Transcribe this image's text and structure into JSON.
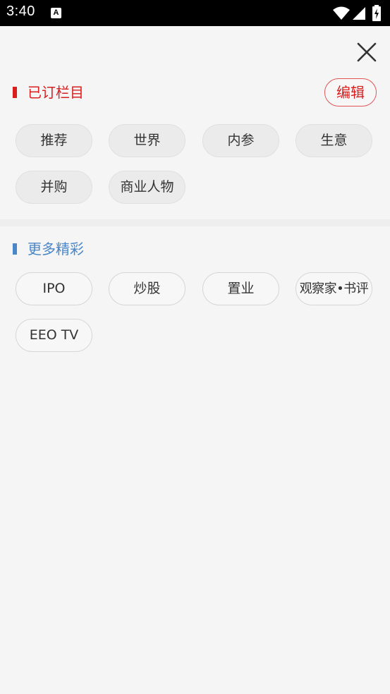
{
  "status_bar": {
    "time": "3:40",
    "notification_icon_letter": "A"
  },
  "colors": {
    "subscribed_accent": "#d81e1e",
    "more_accent": "#4a86c8",
    "background": "#f5f5f5"
  },
  "subscribed": {
    "title": "已订栏目",
    "edit_label": "编辑",
    "items": [
      "推荐",
      "世界",
      "内参",
      "生意",
      "并购",
      "商业人物"
    ]
  },
  "more": {
    "title": "更多精彩",
    "items": [
      "IPO",
      "炒股",
      "置业",
      "观察家•书评",
      "EEO TV"
    ]
  },
  "icons": {
    "close": "close-icon",
    "wifi": "wifi-icon",
    "signal": "signal-icon",
    "battery": "battery-icon"
  }
}
